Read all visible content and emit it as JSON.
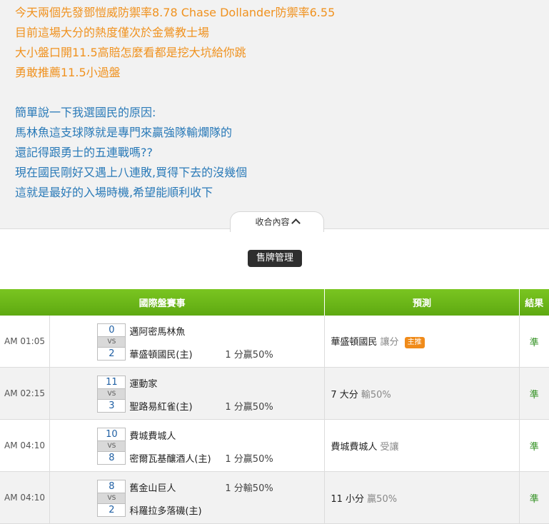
{
  "article": {
    "lines_orange": [
      "今天兩個先發鄧愷威防禦率8.78 Chase Dollander防禦率6.55",
      "目前這場大分的熱度僅次於金鶯教士場",
      "大小盤口開11.5高賠怎麼看都是挖大坑給你跳",
      "勇敢推薦11.5小過盤"
    ],
    "lines_blue": [
      "簡單說一下我選國民的原因:",
      "馬林魚這支球隊就是專門來贏強隊輸爛隊的",
      "還記得跟勇士的五連戰嗎??",
      "現在國民剛好又遇上八連敗,買得下去的沒幾個",
      "這就是最好的入場時機,希望能順利收下"
    ],
    "collapse_label": "收合內容"
  },
  "sell_button": "售牌管理",
  "table": {
    "headers": {
      "match": "國際盤賽事",
      "prediction": "預測",
      "result": "結果"
    },
    "vs_label": "VS",
    "rows": [
      {
        "time": "AM 01:05",
        "score_top": "0",
        "score_bottom": "2",
        "team_top": "邁阿密馬林魚",
        "team_bottom": "華盛頓國民(主)",
        "note_top": "",
        "note_bottom": "1 分贏50%",
        "pred_main": "華盛頓國民",
        "pred_sub": "讓分",
        "pred_tag": "主推",
        "result": "準"
      },
      {
        "time": "AM 02:15",
        "score_top": "11",
        "score_bottom": "3",
        "team_top": "運動家",
        "team_bottom": "聖路易紅雀(主)",
        "note_top": "",
        "note_bottom": "1 分贏50%",
        "pred_main": "7 大分",
        "pred_sub": "輸50%",
        "pred_tag": "",
        "result": "準"
      },
      {
        "time": "AM 04:10",
        "score_top": "10",
        "score_bottom": "8",
        "team_top": "費城費城人",
        "team_bottom": "密爾瓦基釀酒人(主)",
        "note_top": "",
        "note_bottom": "1 分贏50%",
        "pred_main": "費城費城人",
        "pred_sub": "受讓",
        "pred_tag": "",
        "result": "準"
      },
      {
        "time": "AM 04:10",
        "score_top": "8",
        "score_bottom": "2",
        "team_top": "舊金山巨人",
        "team_bottom": "科羅拉多落磯(主)",
        "note_top": "1 分輸50%",
        "note_bottom": "",
        "pred_main": "11 小分",
        "pred_sub": "贏50%",
        "pred_tag": "",
        "result": "準"
      }
    ]
  }
}
